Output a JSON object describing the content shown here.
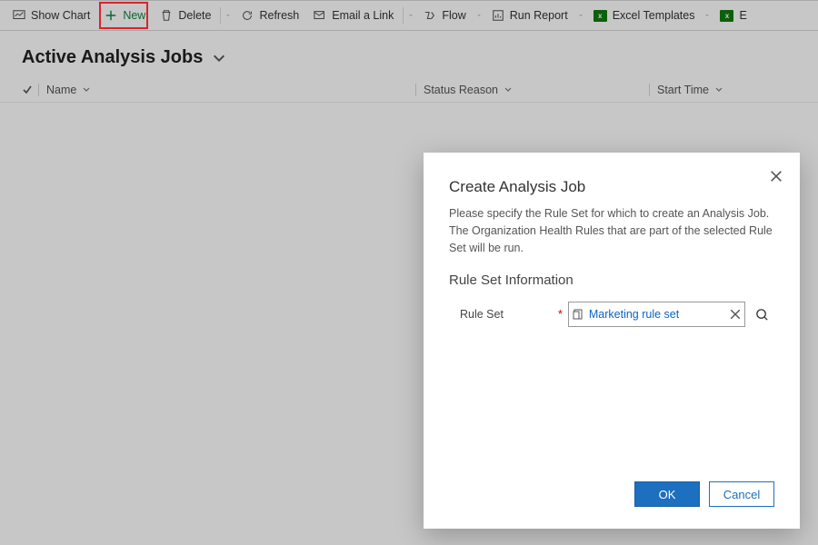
{
  "toolbar": {
    "show_chart": "Show Chart",
    "new": "New",
    "delete": "Delete",
    "refresh": "Refresh",
    "email_link": "Email a Link",
    "flow": "Flow",
    "run_report": "Run Report",
    "excel_templates": "Excel Templates",
    "excel_tail": "E"
  },
  "view": {
    "title": "Active Analysis Jobs"
  },
  "columns": {
    "name": "Name",
    "status": "Status Reason",
    "start": "Start Time"
  },
  "dialog": {
    "title": "Create Analysis Job",
    "body": "Please specify the Rule Set for which to create an Analysis Job. The Organization Health Rules that are part of the selected Rule Set will be run.",
    "subtitle": "Rule Set Information",
    "field_label": "Rule Set",
    "lookup_value": "Marketing rule set",
    "ok": "OK",
    "cancel": "Cancel"
  }
}
